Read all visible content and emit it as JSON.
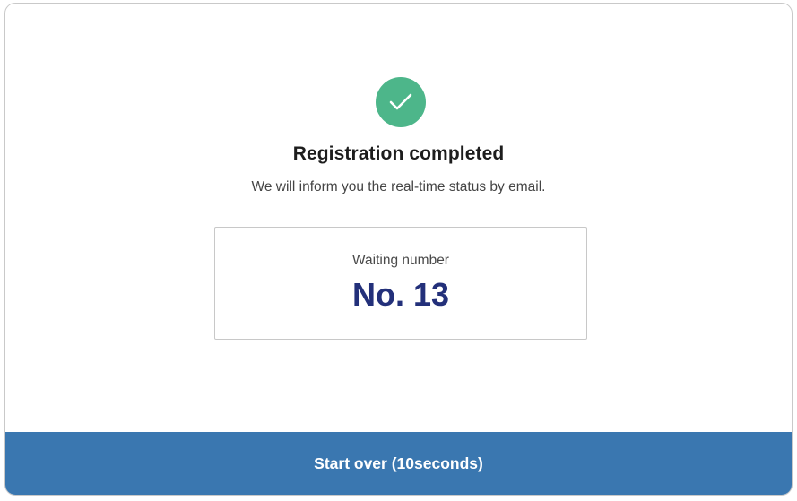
{
  "status": {
    "icon": "checkmark-icon",
    "icon_color": "#4db68a",
    "title": "Registration completed",
    "message": "We will inform you the real-time status by email."
  },
  "waiting": {
    "label": "Waiting number",
    "number": "No. 13",
    "number_color": "#23307a"
  },
  "footer": {
    "start_over_label": "Start over (10seconds)",
    "button_color": "#3a77b0"
  }
}
